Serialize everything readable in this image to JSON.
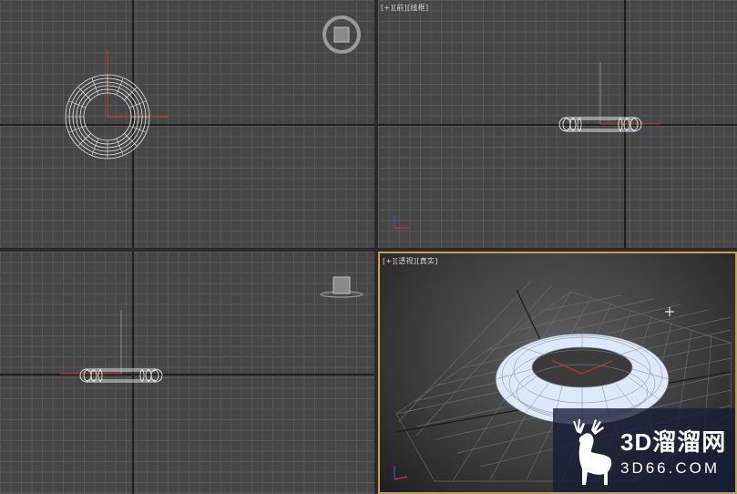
{
  "viewports": {
    "top": {
      "label": ""
    },
    "front": {
      "label": "[+][前][线框]"
    },
    "left": {
      "label": ""
    },
    "perspective": {
      "label": "[+][透视][真实]"
    }
  },
  "watermark": {
    "brand_cn": "3D溜溜网",
    "brand_en": "3D66.COM",
    "deer_icon": "deer-logo-icon"
  },
  "colors": {
    "grid_bg": "#464646",
    "grid_line": "#585858",
    "active_border": "#c9a34a",
    "torus_fill": "#d9e6f7",
    "axis_red": "#c83a2a"
  }
}
